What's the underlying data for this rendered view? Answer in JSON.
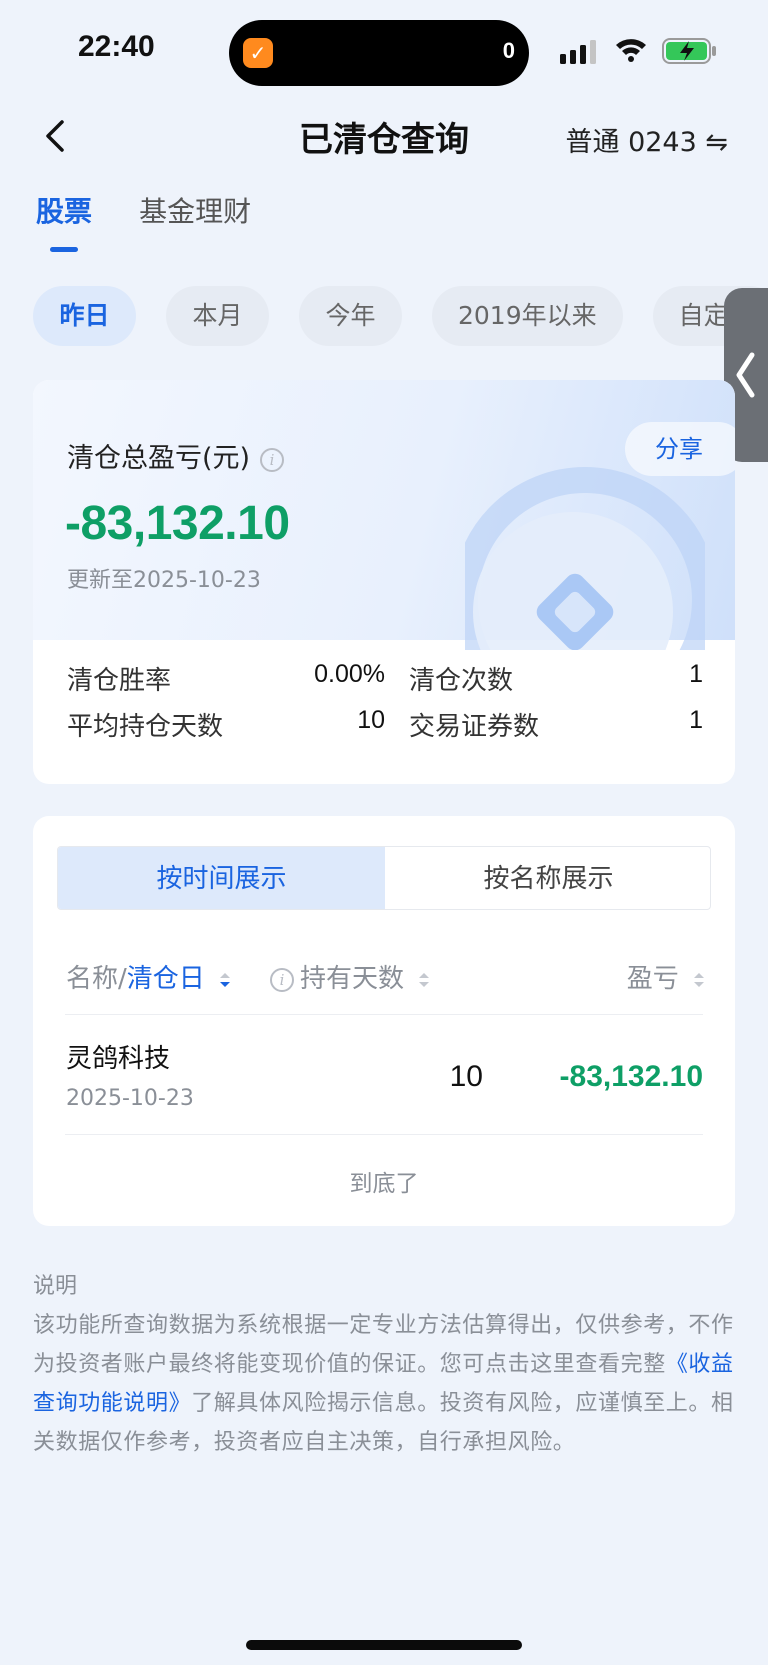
{
  "status": {
    "time": "22:40",
    "island_count": "0"
  },
  "nav": {
    "title": "已清仓查询",
    "account": "普通 0243",
    "swap_symbol": "⇋"
  },
  "main_tabs": [
    {
      "label": "股票"
    },
    {
      "label": "基金理财"
    }
  ],
  "periods": [
    {
      "label": "昨日"
    },
    {
      "label": "本月"
    },
    {
      "label": "今年"
    },
    {
      "label": "2019年以来"
    },
    {
      "label": "自定义"
    }
  ],
  "summary": {
    "label": "清仓总盈亏(元)",
    "info_glyph": "i",
    "share_label": "分享",
    "value": "-83,132.10",
    "updated": "更新至2025-10-23",
    "stats": [
      {
        "label": "清仓胜率",
        "value": "0.00%"
      },
      {
        "label": "清仓次数",
        "value": "1"
      },
      {
        "label": "平均持仓天数",
        "value": "10"
      },
      {
        "label": "交易证券数",
        "value": "1"
      }
    ]
  },
  "list": {
    "segments": [
      {
        "label": "按时间展示"
      },
      {
        "label": "按名称展示"
      }
    ],
    "columns": {
      "name_prefix": "名称/",
      "name_sort": "清仓日",
      "days": "持有天数",
      "pl": "盈亏"
    },
    "rows": [
      {
        "name": "灵鸽科技",
        "date": "2025-10-23",
        "days": "10",
        "pl": "-83,132.10"
      }
    ],
    "end_text": "到底了"
  },
  "notes": {
    "title": "说明",
    "text_1": "该功能所查询数据为系统根据一定专业方法估算得出，仅供参考，不作为投资者账户最终将能变现价值的保证。您可点击这里查看完整",
    "link": "《收益查询功能说明》",
    "text_2": "了解具体风险揭示信息。投资有风险，应谨慎至上。相关数据仅作参考，投资者应自主决策，自行承担风险。"
  },
  "colors": {
    "accent": "#1a64e0",
    "loss_green": "#0e9f66",
    "background": "#eef3fb"
  }
}
